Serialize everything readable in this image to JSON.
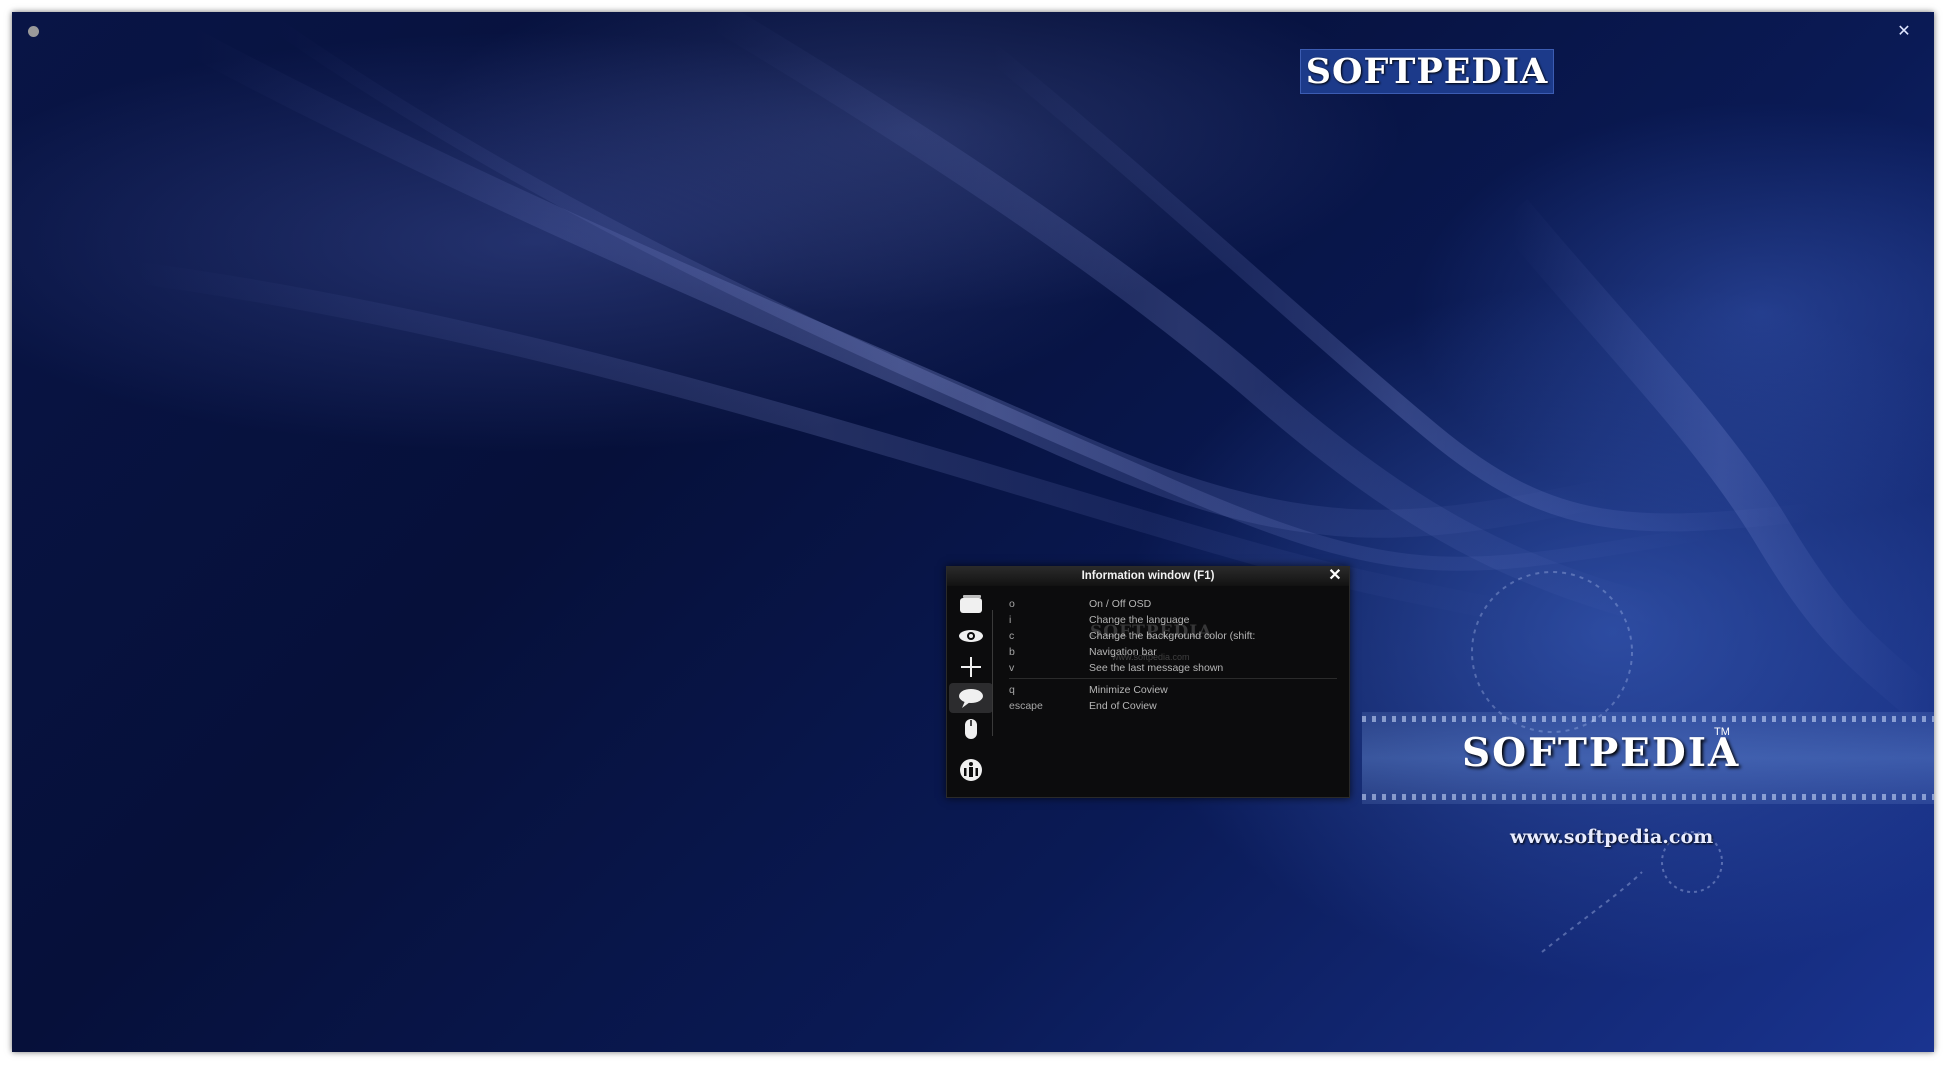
{
  "window": {
    "close_glyph": "✕",
    "control_dot": "window-menu-dot"
  },
  "branding": {
    "logo_top": "SOFTPEDIA",
    "logo_big": "SOFTPEDIA",
    "trademark": "TM",
    "url": "www.softpedia.com",
    "watermark": "SOFTPEDIA",
    "watermark_url": "www.softpedia.com"
  },
  "info_window": {
    "title": "Information window  (F1)",
    "close_glyph": "✕",
    "sidebar": [
      {
        "icon": "screen-icon",
        "active": false
      },
      {
        "icon": "eye-icon",
        "active": false
      },
      {
        "icon": "crosshair-icon",
        "active": false
      },
      {
        "icon": "speech-bubble-icon",
        "active": true
      },
      {
        "icon": "mouse-icon",
        "active": false
      },
      {
        "icon": "info-icon",
        "active": false
      }
    ],
    "shortcuts": [
      {
        "key": "o",
        "description": "On / Off OSD"
      },
      {
        "key": "i",
        "description": "Change the language"
      },
      {
        "key": "c",
        "description": "Change the background color (shift:"
      },
      {
        "key": "b",
        "description": "Navigation bar"
      },
      {
        "key": "v",
        "description": "See the last message shown"
      },
      {
        "key": "q",
        "description": "Minimize Coview"
      },
      {
        "key": "escape",
        "description": "End of Coview"
      }
    ]
  },
  "colors": {
    "background": "#06103a",
    "panel": "#0c0c0d",
    "text": "#b6b6b6"
  }
}
